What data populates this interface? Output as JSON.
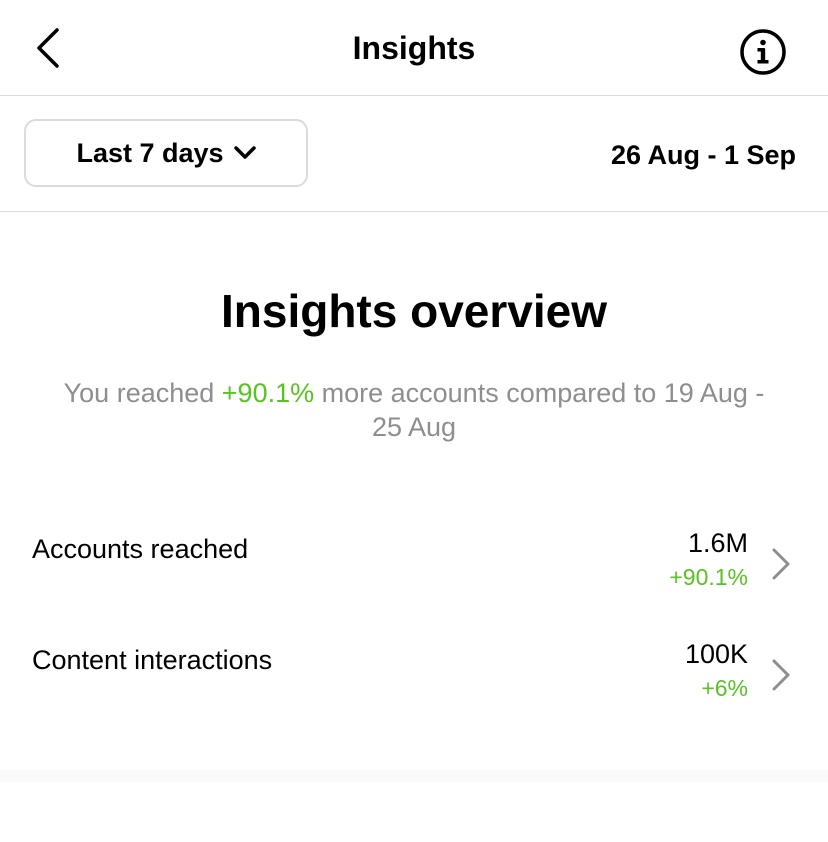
{
  "header": {
    "title": "Insights",
    "back_icon": "chevron-left-icon",
    "info_icon": "info-icon"
  },
  "filter": {
    "range_label": "Last 7 days",
    "range_icon": "chevron-down-icon",
    "date_range": "26 Aug - 1 Sep"
  },
  "overview": {
    "title": "Insights overview",
    "text_before": "You reached ",
    "highlight": "+90.1%",
    "text_after": " more accounts compared to 19 Aug - 25 Aug"
  },
  "metrics": [
    {
      "label": "Accounts reached",
      "value": "1.6M",
      "change": "+90.1%"
    },
    {
      "label": "Content interactions",
      "value": "100K",
      "change": "+6%"
    }
  ],
  "colors": {
    "positive": "#58c322",
    "muted_text": "#8e8e8e",
    "divider": "#dbdbdb"
  }
}
